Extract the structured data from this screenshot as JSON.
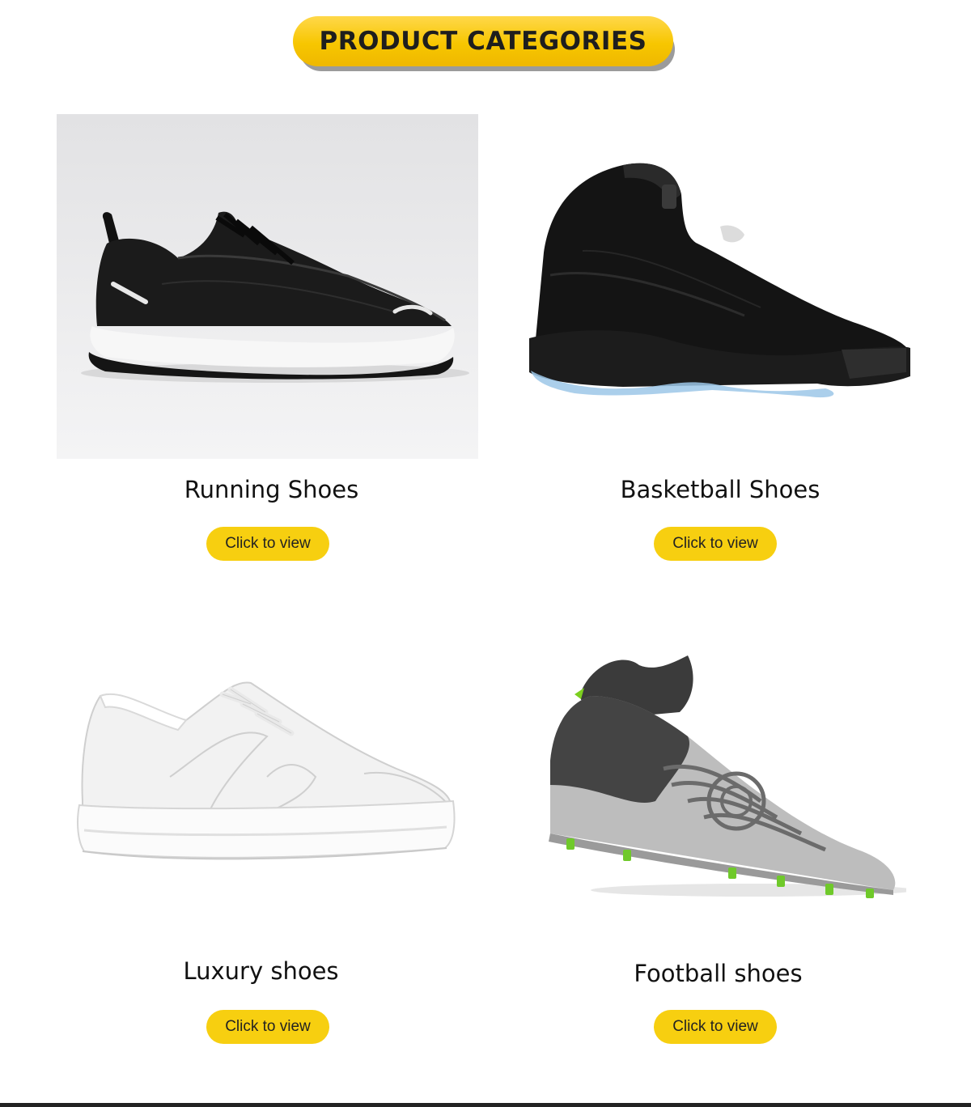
{
  "header": {
    "title": "PRODUCT CATEGORIES"
  },
  "categories": [
    {
      "title": "Running Shoes",
      "button_label": "Click to view"
    },
    {
      "title": "Basketball Shoes",
      "button_label": "Click to view"
    },
    {
      "title": "Luxury shoes",
      "button_label": "Click to view"
    },
    {
      "title": "Football shoes",
      "button_label": "Click to view"
    }
  ],
  "colors": {
    "accent": "#f7cf10",
    "banner": "#f7c600",
    "text": "#111111"
  }
}
